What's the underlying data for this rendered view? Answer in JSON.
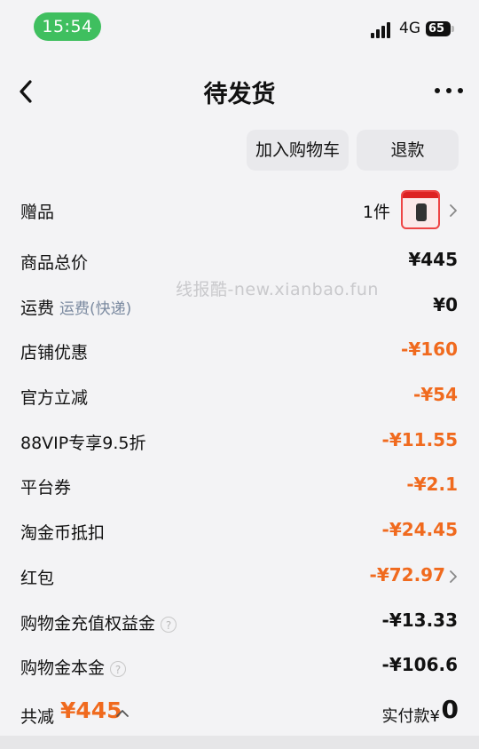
{
  "status": {
    "time": "15:54",
    "network": "4G",
    "battery": "65"
  },
  "nav": {
    "title": "待发货"
  },
  "actions": {
    "add_to_cart": "加入购物车",
    "refund": "退款"
  },
  "rows": {
    "gift": {
      "label": "赠品",
      "count": "1件"
    },
    "total_price": {
      "label": "商品总价",
      "value": "¥445"
    },
    "shipping": {
      "label": "运费",
      "sub": "运费(快递)",
      "value": "¥0"
    },
    "store_discount": {
      "label": "店铺优惠",
      "value": "-¥160"
    },
    "official_discount": {
      "label": "官方立减",
      "value": "-¥54"
    },
    "vip": {
      "label": "88VIP专享9.5折",
      "value": "-¥11.55"
    },
    "platform_coupon": {
      "label": "平台券",
      "value": "-¥2.1"
    },
    "coins": {
      "label": "淘金币抵扣",
      "value": "-¥24.45"
    },
    "red_packet": {
      "label": "红包",
      "value": "-¥72.97"
    },
    "credit_bonus": {
      "label": "购物金充值权益金",
      "value": "-¥13.33"
    },
    "credit_principal": {
      "label": "购物金本金",
      "value": "-¥106.6"
    }
  },
  "watermark": "线报酷-new.xianbao.fun",
  "footer": {
    "total_label": "共减",
    "total_value": "¥445",
    "pay_label": "实付款¥",
    "pay_value": "0"
  },
  "colors": {
    "accent": "#f06a1e",
    "time_pill": "#3fbf5f",
    "sub_text": "#7b8aa0"
  }
}
